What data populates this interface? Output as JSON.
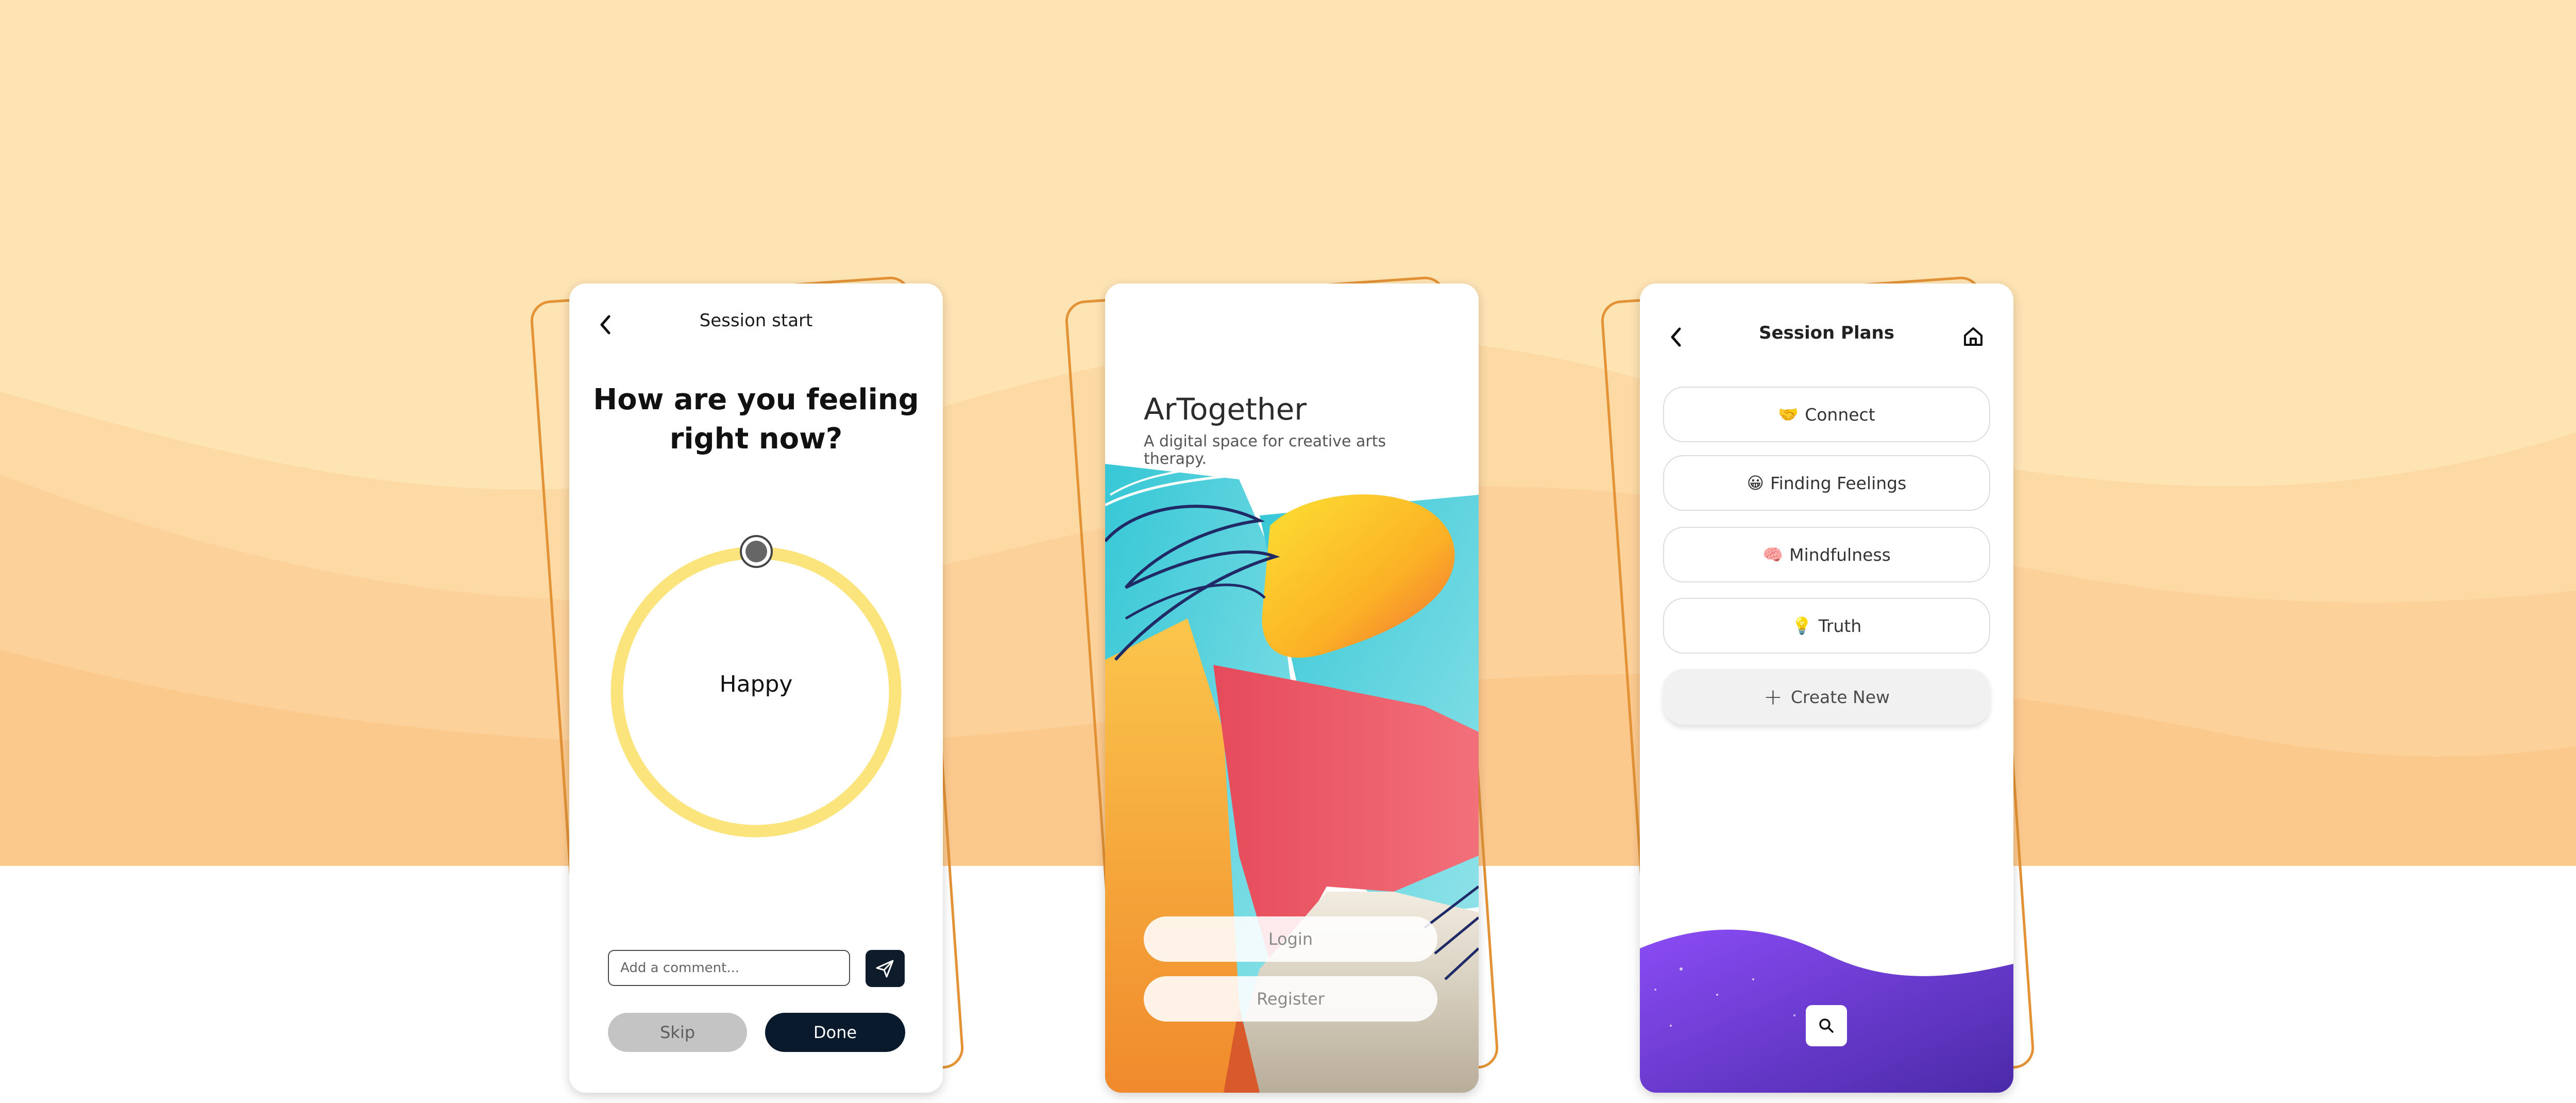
{
  "colors": {
    "background_top": "#fee4b3",
    "background_wave_mid": "#fdd49b",
    "background_wave_deep": "#fcc58a",
    "frame_outline": "#e39236",
    "mood_ring": "#fce47c",
    "button_dark": "#081a2c",
    "button_grey": "#c4c4c4",
    "wave_purple": "#7a3ff0"
  },
  "session_start": {
    "title": "Session start",
    "back_icon": "chevron-left-icon",
    "question": "How are you feeling right now?",
    "mood_value": "Happy",
    "comment_placeholder": "Add a comment...",
    "send_icon": "paper-plane-icon",
    "skip_label": "Skip",
    "done_label": "Done"
  },
  "welcome": {
    "app_name": "ArTogether",
    "tagline": "A digital space for creative arts therapy.",
    "login_label": "Login",
    "register_label": "Register"
  },
  "session_plans": {
    "title": "Session Plans",
    "back_icon": "chevron-left-icon",
    "home_icon": "home-icon",
    "plans": [
      {
        "emoji": "🤝",
        "label": "Connect"
      },
      {
        "emoji": "😀",
        "label": "Finding Feelings"
      },
      {
        "emoji": "🧠",
        "label": "Mindfulness"
      },
      {
        "emoji": "💡",
        "label": "Truth"
      }
    ],
    "create_label": "Create New",
    "search_icon": "search-icon"
  }
}
